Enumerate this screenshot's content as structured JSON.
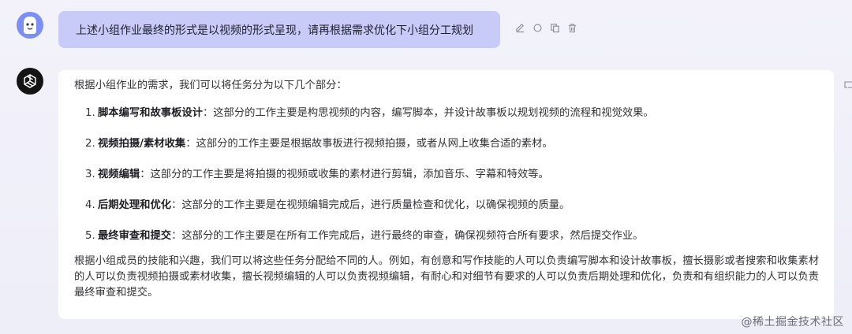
{
  "conversation": {
    "user_message": {
      "avatar_icon": "smiley-face-icon",
      "text": "上述小组作业最终的形式是以视频的形式呈现，请再根据需求优化下小组分工规划",
      "actions": [
        "edit-icon",
        "refresh-icon",
        "copy-icon",
        "delete-icon"
      ]
    },
    "assistant_message": {
      "avatar_icon": "openai-logo-icon",
      "intro": "根据小组作业的需求，我们可以将任务分为以下几个部分：",
      "items": [
        {
          "num": "1.",
          "title": "脚本编写和故事板设计",
          "desc": "：这部分的工作主要是构思视频的内容，编写脚本，并设计故事板以规划视频的流程和视觉效果。"
        },
        {
          "num": "2.",
          "title": "视频拍摄/素材收集",
          "desc": "：这部分的工作主要是根据故事板进行视频拍摄，或者从网上收集合适的素材。"
        },
        {
          "num": "3.",
          "title": "视频编辑",
          "desc": "：这部分的工作主要是将拍摄的视频或收集的素材进行剪辑，添加音乐、字幕和特效等。"
        },
        {
          "num": "4.",
          "title": "后期处理和优化",
          "desc": "：这部分的工作主要是在视频编辑完成后，进行质量检查和优化，以确保视频的质量。"
        },
        {
          "num": "5.",
          "title": "最终审查和提交",
          "desc": "：这部分的工作主要是在所有工作完成后，进行最终的审查，确保视频符合所有要求，然后提交作业。"
        }
      ],
      "outro": "根据小组成员的技能和兴趣，我们可以将这些任务分配给不同的人。例如，有创意和写作技能的人可以负责编写脚本和设计故事板，擅长摄影或者搜索和收集素材的人可以负责视频拍摄或素材收集，擅长视频编辑的人可以负责视频编辑，有耐心和对细节有要求的人可以负责后期处理和优化，负责和有组织能力的人可以负责最终审查和提交。"
    }
  },
  "watermark": "@稀土掘金技术社区",
  "colors": {
    "user_bubble": "#c8caf7",
    "user_avatar": "#7c8ef0",
    "bot_avatar": "#141414",
    "background": "#f1f0fa"
  }
}
